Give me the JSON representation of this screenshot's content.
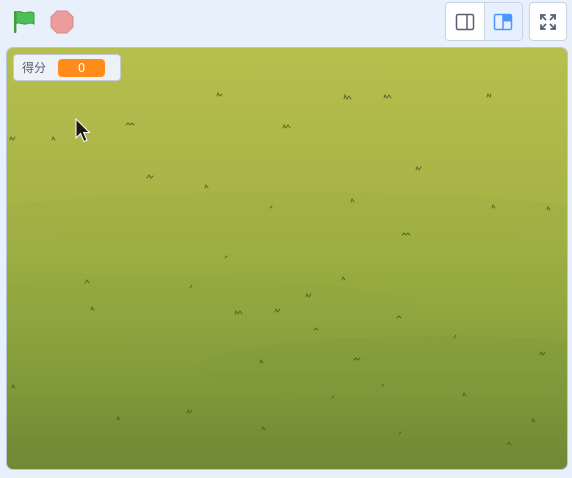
{
  "controls": {
    "green_flag_icon": "green-flag-icon",
    "stop_icon": "stop-sign-icon",
    "small_stage_icon": "small-stage-icon",
    "normal_stage_icon": "normal-stage-icon",
    "fullscreen_icon": "fullscreen-icon"
  },
  "monitor": {
    "label": "得分",
    "value": "0"
  },
  "colors": {
    "flag_green": "#4cbf56",
    "stop_red": "#ec9c9c",
    "monitor_orange": "#ff8c1a",
    "accent_blue": "#855cd6",
    "stage_top": "#b6bd4b",
    "stage_bottom": "#6f8a38"
  }
}
